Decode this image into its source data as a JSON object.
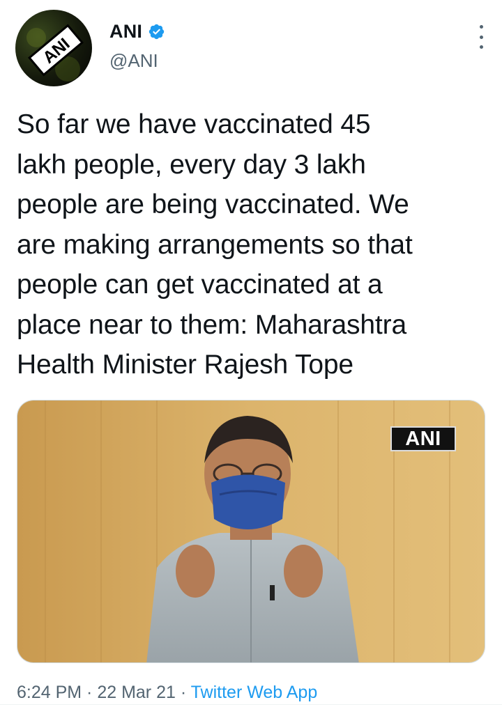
{
  "author": {
    "display_name": "ANI",
    "handle": "@ANI",
    "verified": true,
    "avatar_logo_text": "ANI"
  },
  "tweet": {
    "text_lines": [
      "So far we have vaccinated 45",
      "lakh people, every day 3 lakh",
      "people are being vaccinated. We",
      "are making arrangements so that",
      "people can get vaccinated at a",
      "place near to them: Maharashtra",
      "Health Minister Rajesh Tope"
    ]
  },
  "media": {
    "watermark": "ANI"
  },
  "footer": {
    "time": "6:24 PM",
    "separator": " · ",
    "date": "22 Mar 21",
    "source": "Twitter Web App"
  },
  "colors": {
    "text": "#0f1419",
    "secondary": "#536471",
    "accent": "#1d9bf0"
  },
  "icons": {
    "verified": "verified-badge-icon",
    "more": "more-options-icon"
  }
}
